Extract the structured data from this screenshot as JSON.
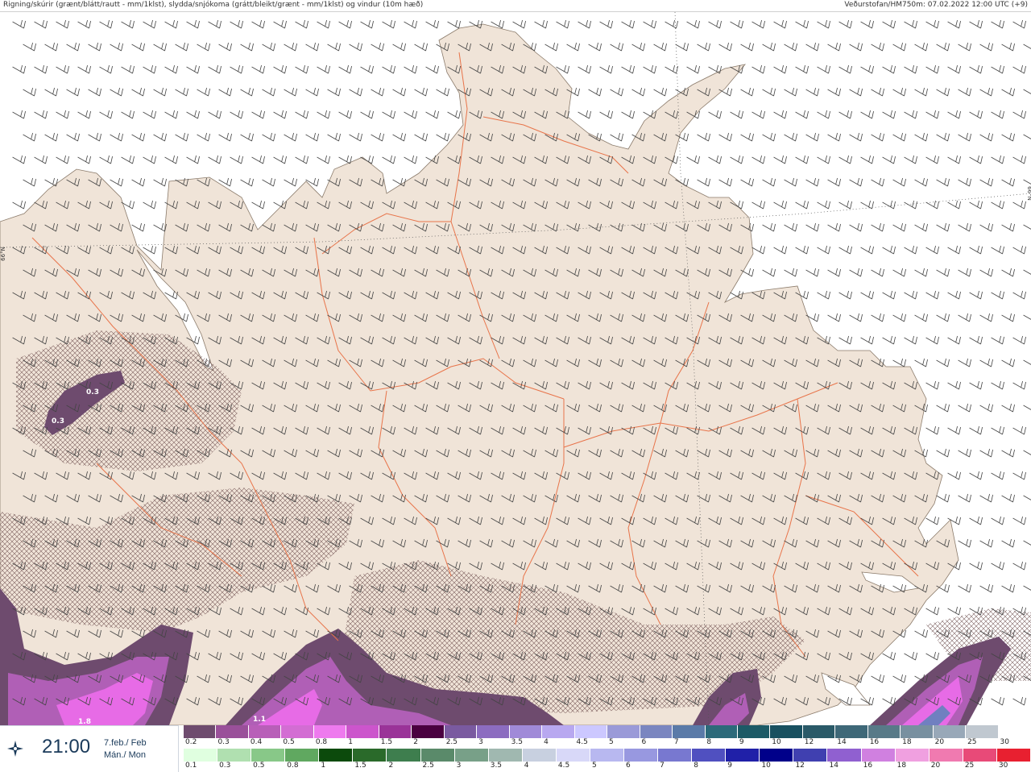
{
  "header": {
    "title": "Rigning/skúrir (grænt/blátt/rautt - mm/1klst), slydda/snjókoma (grátt/bleikt/grænt - mm/1klst) og vindur (10m hæð)",
    "source": "Veðurstofan/HM750m: 07.02.2022 12:00 UTC (+9)"
  },
  "timebox": {
    "icon": "compass-star-icon",
    "time": "21:00",
    "date_line1": "7.feb./ Feb",
    "date_line2": "Mán./ Mon"
  },
  "map": {
    "latitude_label": "66°N",
    "value_labels": [
      {
        "id": "v1",
        "text": "0.3"
      },
      {
        "id": "v2",
        "text": "0.3"
      },
      {
        "id": "v3",
        "text": "1.8"
      },
      {
        "id": "v4",
        "text": "1.1"
      }
    ],
    "colors": {
      "sea": "#ffffff",
      "land": "#f0e4d8",
      "roads": "#e8744a",
      "snow_dark": "#6e4b6e",
      "snow_mid": "#b05fb6",
      "snow_bright": "#e76be6",
      "wind_barbs": "#444444"
    }
  },
  "legend_snow": {
    "labels": [
      "0.2",
      "0.3",
      "0.4",
      "0.5",
      "0.8",
      "1",
      "1.5",
      "2",
      "2.5",
      "3",
      "3.5",
      "4",
      "4.5",
      "5",
      "6",
      "7",
      "8",
      "9",
      "10",
      "12",
      "14",
      "16",
      "18",
      "20",
      "25",
      "30"
    ],
    "colors": [
      "#6e4b6e",
      "#9a509a",
      "#b85fb8",
      "#d36dd3",
      "#ee7aee",
      "#cc55cc",
      "#9a3398",
      "#4a0040",
      "#7a5aa0",
      "#8c6cc0",
      "#a08ad8",
      "#b8a8f0",
      "#ccc8ff",
      "#9a9ad8",
      "#7a86c0",
      "#5a7aa8",
      "#2c6a7a",
      "#1c5a66",
      "#185060",
      "#2a5a68",
      "#3e6878",
      "#587a88",
      "#7890a0",
      "#98a8b8",
      "#c0c8d0",
      "#ffffff"
    ]
  },
  "legend_rain": {
    "labels": [
      "0.1",
      "0.3",
      "0.5",
      "0.8",
      "1",
      "1.5",
      "2",
      "2.5",
      "3",
      "3.5",
      "4",
      "4.5",
      "5",
      "6",
      "7",
      "8",
      "9",
      "10",
      "12",
      "14",
      "16",
      "18",
      "20",
      "25",
      "30"
    ],
    "colors": [
      "#e0ffe0",
      "#b0e0b0",
      "#88c888",
      "#60a860",
      "#0c4a0c",
      "#2a6a2a",
      "#3e7e4e",
      "#5a8a6a",
      "#78a088",
      "#a0b8b0",
      "#c8d0e0",
      "#d8d8f8",
      "#b8b8f0",
      "#9898e0",
      "#7878d0",
      "#5050c0",
      "#2020a8",
      "#00008a",
      "#4040b0",
      "#9060d0",
      "#d080e0",
      "#f0a0e0",
      "#f07ab0",
      "#e84a78",
      "#e82030"
    ]
  }
}
